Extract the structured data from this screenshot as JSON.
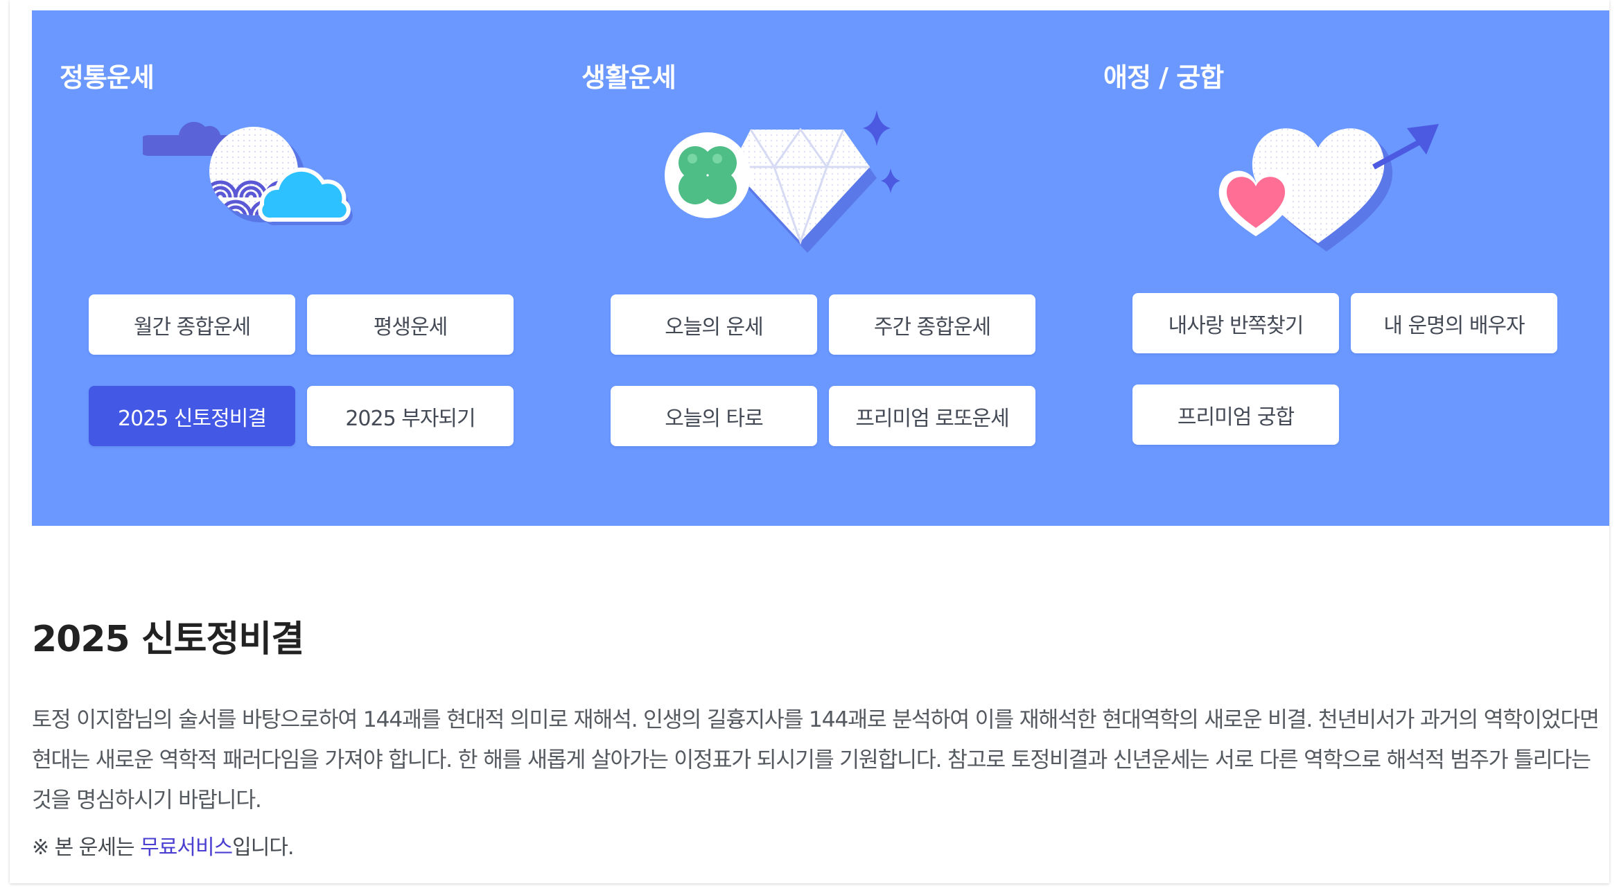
{
  "categories": [
    {
      "title": "정통운세",
      "illustration": "moon-cloud-icon",
      "buttons": [
        {
          "label": "월간 종합운세",
          "active": false
        },
        {
          "label": "평생운세",
          "active": false
        },
        {
          "label": "2025 신토정비결",
          "active": true
        },
        {
          "label": "2025 부자되기",
          "active": false
        }
      ]
    },
    {
      "title": "생활운세",
      "illustration": "clover-diamond-icon",
      "buttons": [
        {
          "label": "오늘의 운세",
          "active": false
        },
        {
          "label": "주간 종합운세",
          "active": false
        },
        {
          "label": "오늘의 타로",
          "active": false
        },
        {
          "label": "프리미엄 로또운세",
          "active": false
        }
      ]
    },
    {
      "title": "애정 / 궁합",
      "illustration": "hearts-arrow-icon",
      "buttons": [
        {
          "label": "내사랑 반쪽찾기",
          "active": false
        },
        {
          "label": "내 운명의 배우자",
          "active": false
        },
        {
          "label": "프리미엄 궁합",
          "active": false
        }
      ]
    }
  ],
  "content": {
    "title": "2025 신토정비결",
    "description": "토정 이지함님의 술서를 바탕으로하여 144괘를 현대적 의미로 재해석. 인생의 길흉지사를 144괘로 분석하여 이를 재해석한 현대역학의 새로운 비결. 천년비서가 과거의 역학이었다면 현대는 새로운 역학적 패러다임을 가져야 합니다. 한 해를 새롭게 살아가는 이정표가 되시기를 기원합니다. 참고로 토정비결과 신년운세는 서로 다른 역학으로 해석적 범주가 틀리다는 것을 명심하시기 바랍니다.",
    "note_prefix": "※ 본 운세는 ",
    "note_highlight": "무료서비스",
    "note_suffix": "입니다."
  },
  "colors": {
    "hero_background": "#6a98ff",
    "active_button": "#4458e6",
    "highlight_text": "#4a3fd0"
  }
}
